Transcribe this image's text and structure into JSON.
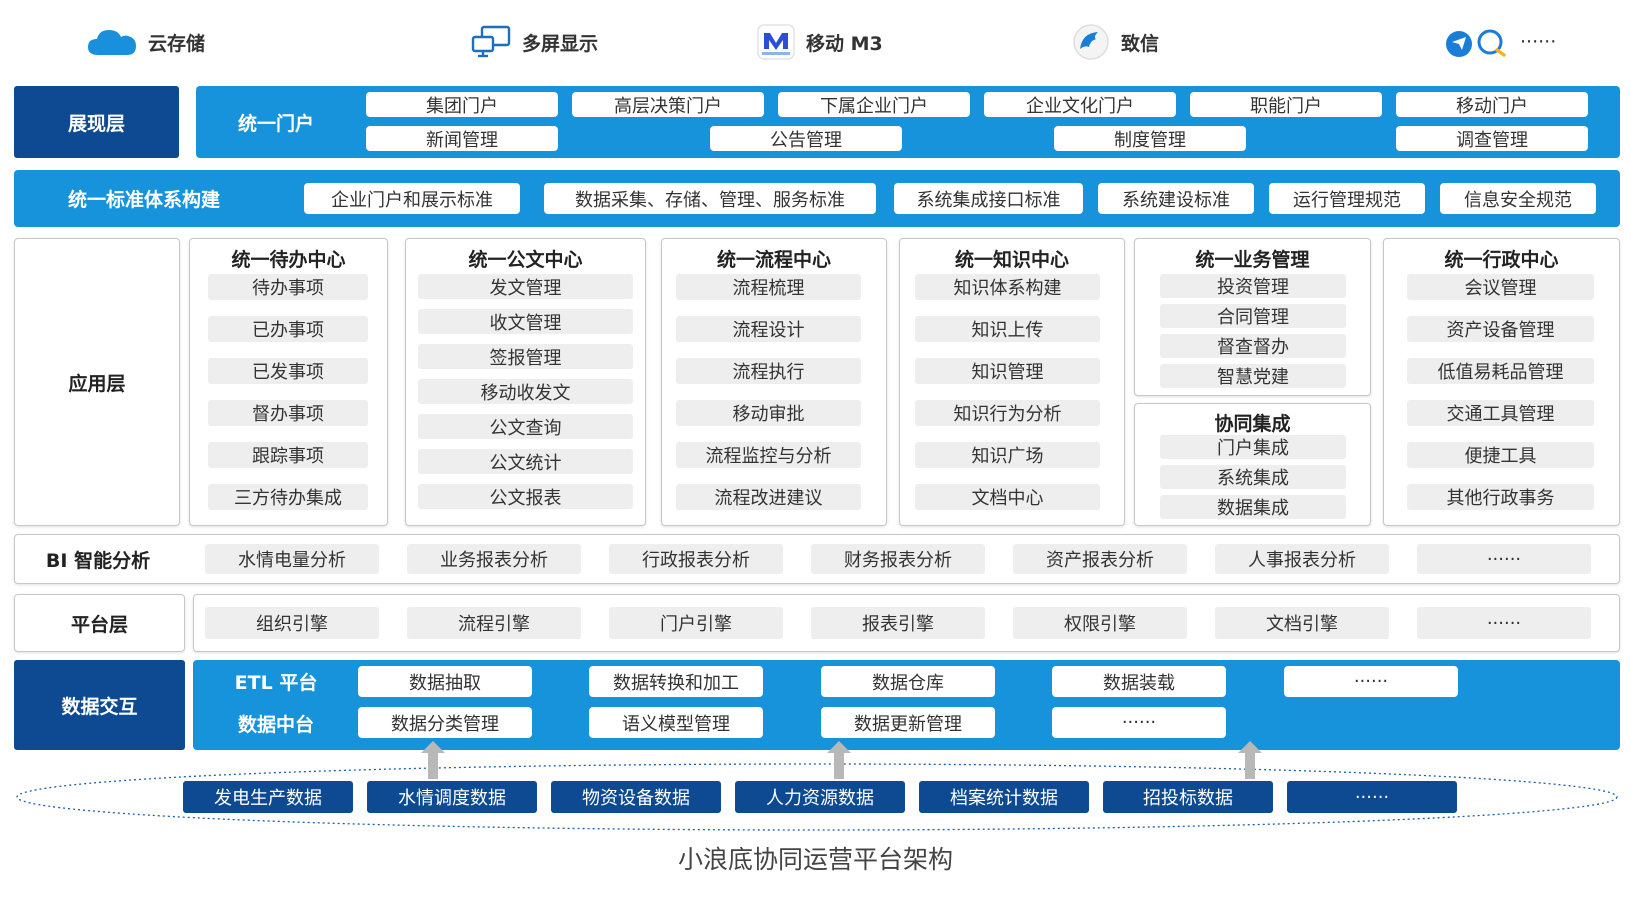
{
  "top_bar": [
    {
      "label": "云存储",
      "icon": "cloud-icon"
    },
    {
      "label": "多屏显示",
      "icon": "multi-screen-icon"
    },
    {
      "label": "移动 M3",
      "icon": "m3-app-icon"
    },
    {
      "label": "致信",
      "icon": "zhixin-app-icon"
    },
    {
      "label": "······",
      "icon": "chat-icons"
    }
  ],
  "presentation": {
    "layer_label": "展现层",
    "portal_label": "统一门户",
    "row1": [
      "集团门户",
      "高层决策门户",
      "下属企业门户",
      "企业文化门户",
      "职能门户",
      "移动门户"
    ],
    "row2": [
      "新闻管理",
      "公告管理",
      "制度管理",
      "调查管理"
    ]
  },
  "standards": {
    "label": "统一标准体系构建",
    "items": [
      "企业门户和展示标准",
      "数据采集、存储、管理、服务标准",
      "系统集成接口标准",
      "系统建设标准",
      "运行管理规范",
      "信息安全规范"
    ]
  },
  "application": {
    "layer_label": "应用层",
    "todo": {
      "title": "统一待办中心",
      "items": [
        "待办事项",
        "已办事项",
        "已发事项",
        "督办事项",
        "跟踪事项",
        "三方待办集成"
      ]
    },
    "doc": {
      "title": "统一公文中心",
      "items": [
        "发文管理",
        "收文管理",
        "签报管理",
        "移动收发文",
        "公文查询",
        "公文统计",
        "公文报表"
      ]
    },
    "flow": {
      "title": "统一流程中心",
      "items": [
        "流程梳理",
        "流程设计",
        "流程执行",
        "移动审批",
        "流程监控与分析",
        "流程改进建议"
      ]
    },
    "knowledge": {
      "title": "统一知识中心",
      "items": [
        "知识体系构建",
        "知识上传",
        "知识管理",
        "知识行为分析",
        "知识广场",
        "文档中心"
      ]
    },
    "business": {
      "title": "统一业务管理",
      "items": [
        "投资管理",
        "合同管理",
        "督查督办",
        "智慧党建"
      ]
    },
    "collab": {
      "title": "协同集成",
      "items": [
        "门户集成",
        "系统集成",
        "数据集成"
      ]
    },
    "admin": {
      "title": "统一行政中心",
      "items": [
        "会议管理",
        "资产设备管理",
        "低值易耗品管理",
        "交通工具管理",
        "便捷工具",
        "其他行政事务"
      ]
    }
  },
  "bi": {
    "label": "BI 智能分析",
    "items": [
      "水情电量分析",
      "业务报表分析",
      "行政报表分析",
      "财务报表分析",
      "资产报表分析",
      "人事报表分析",
      "······"
    ]
  },
  "platform": {
    "label": "平台层",
    "items": [
      "组织引擎",
      "流程引擎",
      "门户引擎",
      "报表引擎",
      "权限引擎",
      "文档引擎",
      "······"
    ]
  },
  "data_exchange": {
    "label": "数据交互",
    "etl_label": "ETL 平台",
    "middle_label": "数据中台",
    "etl_items": [
      "数据抽取",
      "数据转换和加工",
      "数据仓库",
      "数据装载",
      "······"
    ],
    "middle_items": [
      "数据分类管理",
      "语义模型管理",
      "数据更新管理",
      "······"
    ]
  },
  "sources": [
    "发电生产数据",
    "水情调度数据",
    "物资设备数据",
    "人力资源数据",
    "档案统计数据",
    "招投标数据",
    "······"
  ],
  "caption": "小浪底协同运营平台架构",
  "colors": {
    "navy": "#0d4a91",
    "blue": "#1793dc",
    "gray_pill": "#eeeeee",
    "arrow": "#b8b8b8"
  }
}
